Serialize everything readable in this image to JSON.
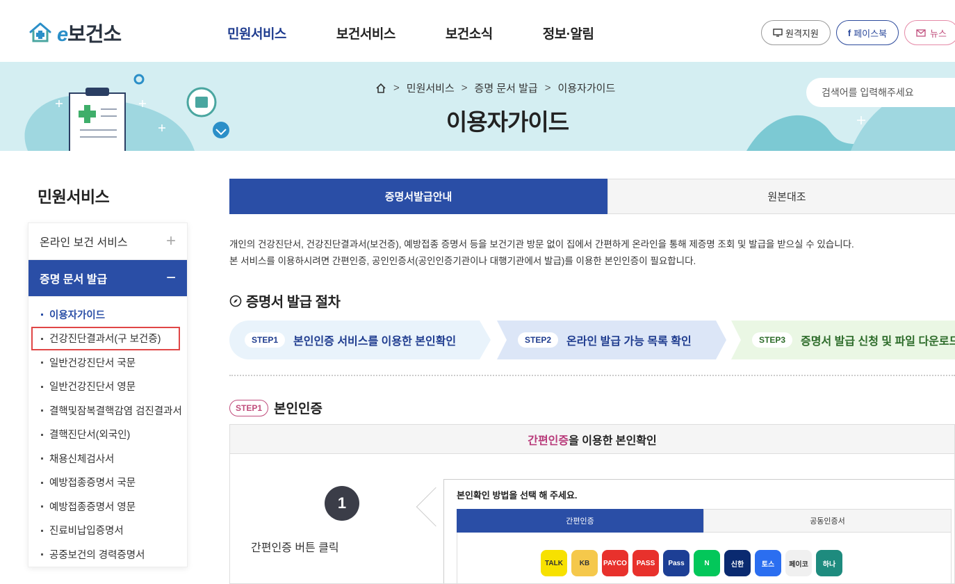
{
  "header": {
    "logo_e": "e",
    "logo_name": "보건소",
    "nav": [
      "민원서비스",
      "보건서비스",
      "보건소식",
      "정보·알림"
    ],
    "util": {
      "remote": "원격지원",
      "facebook": "페이스북",
      "news": "뉴스"
    }
  },
  "banner": {
    "breadcrumb": [
      "민원서비스",
      "증명 문서 발급",
      "이용자가이드"
    ],
    "title": "이용자가이드",
    "search_placeholder": "검색어를 입력해주세요"
  },
  "sidebar": {
    "title": "민원서비스",
    "menu": [
      {
        "label": "온라인 보건 서비스",
        "sign": "+"
      },
      {
        "label": "증명 문서 발급",
        "sign": "−"
      }
    ],
    "sub": [
      "이용자가이드",
      "건강진단결과서(구 보건증)",
      "일반건강진단서 국문",
      "일반건강진단서 영문",
      "결핵및잠복결핵감염 검진결과서",
      "결핵진단서(외국인)",
      "채용신체검사서",
      "예방접종증명서 국문",
      "예방접종증명서 영문",
      "진료비납입증명서",
      "공중보건의 경력증명서"
    ]
  },
  "main": {
    "tabs": [
      "증명서발급안내",
      "원본대조"
    ],
    "intro_1": "개인의 건강진단서, 건강진단결과서(보건증), 예방접종 증명서 등을 보건기관 방문 없이 집에서 간편하게 온라인을 통해 제증명 조회 및 발급을 받으실 수 있습니다.",
    "intro_2": "본 서비스를 이용하시려면 간편인증, 공인인증서(공인인증기관이나 대행기관에서 발급)를 이용한 본인인증이 필요합니다.",
    "section_title": "증명서 발급 절차",
    "steps": [
      {
        "badge": "STEP1",
        "text": "본인인증 서비스를 이용한 본인확인"
      },
      {
        "badge": "STEP2",
        "text": "온라인 발급 가능 목록 확인"
      },
      {
        "badge": "STEP3",
        "text": "증명서 발급 신청 및 파일 다운로드"
      }
    ],
    "step1": {
      "badge": "STEP1",
      "title": "본인인증",
      "panel_head_hl": "간편인증",
      "panel_head_rest": "을 이용한 본인확인",
      "number": "1",
      "number_label": "간편인증 버튼 클릭",
      "bubble_title": "본인확인 방법을 선택 해 주세요.",
      "bubble_tabs": [
        "간편인증",
        "공동인증서"
      ],
      "providers": [
        {
          "name": "TALK",
          "color": "#f7e100"
        },
        {
          "name": "KB",
          "color": "#f5c84b"
        },
        {
          "name": "PAYCO",
          "color": "#e8312c"
        },
        {
          "name": "PASS",
          "color": "#e8312c"
        },
        {
          "name": "Pass",
          "color": "#1d3f95"
        },
        {
          "name": "N",
          "color": "#03c75a"
        },
        {
          "name": "신한",
          "color": "#0a2a70"
        },
        {
          "name": "토스",
          "color": "#2b6ef0"
        },
        {
          "name": "페이코",
          "color": "#f0f0f0"
        },
        {
          "name": "하나",
          "color": "#1e8b7e"
        }
      ]
    }
  }
}
